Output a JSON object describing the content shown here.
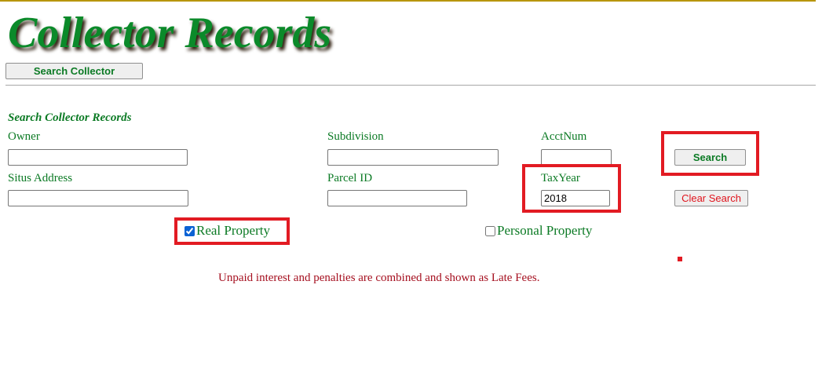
{
  "header": {
    "title": "Collector Records",
    "search_collector_label": "Search Collector"
  },
  "search": {
    "section_title": "Search Collector Records",
    "fields": {
      "owner": {
        "label": "Owner",
        "value": ""
      },
      "subdivision": {
        "label": "Subdivision",
        "value": ""
      },
      "acct_num": {
        "label": "AcctNum",
        "value": ""
      },
      "situs_address": {
        "label": "Situs Address",
        "value": ""
      },
      "parcel_id": {
        "label": "Parcel ID",
        "value": ""
      },
      "tax_year": {
        "label": "TaxYear",
        "value": "2018"
      }
    },
    "search_button_label": "Search",
    "clear_button_label": "Clear Search",
    "real_property": {
      "label": "Real Property",
      "checked": true
    },
    "personal_property": {
      "label": "Personal Property",
      "checked": false
    }
  },
  "notice": "Unpaid interest and penalties are combined and shown as Late Fees.",
  "colors": {
    "title_green": "#0b8a2a",
    "label_green": "#0b7a24",
    "notice_red": "#a50f1f",
    "highlight_red": "#e21b23",
    "top_rule_gold": "#b8960b"
  }
}
